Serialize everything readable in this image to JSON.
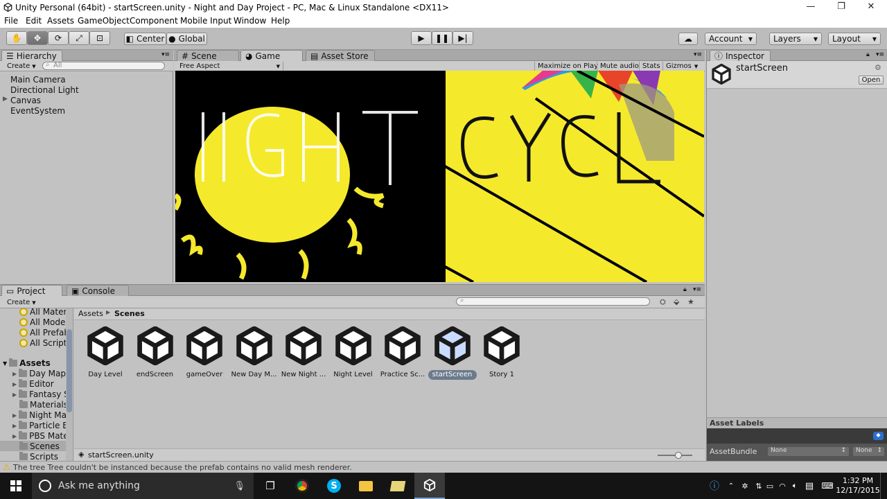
{
  "window": {
    "title": "Unity Personal (64bit) - startScreen.unity - Night and Day Project - PC, Mac & Linux Standalone <DX11>",
    "min": "—",
    "max": "❐",
    "close": "✕"
  },
  "menu": [
    "File",
    "Edit",
    "Assets",
    "GameObject",
    "Component",
    "Mobile Input",
    "Window",
    "Help"
  ],
  "toolbar": {
    "pivot": "Center",
    "space": "Global",
    "account": "Account",
    "layers": "Layers",
    "layout": "Layout"
  },
  "hierarchy": {
    "tab": "Hierarchy",
    "create": "Create",
    "search_placeholder": "All",
    "items": [
      "Main Camera",
      "Directional Light",
      "Canvas",
      "EventSystem"
    ]
  },
  "center_tabs": {
    "scene": "Scene",
    "game": "Game",
    "store": "Asset Store"
  },
  "game_bar": {
    "aspect": "Free Aspect",
    "maximize": "Maximize on Play",
    "mute": "Mute audio",
    "stats": "Stats",
    "gizmos": "Gizmos"
  },
  "inspector": {
    "tab": "Inspector",
    "object": "startScreen",
    "open": "Open",
    "labels_title": "Asset Labels",
    "bundle_label": "AssetBundle",
    "bundle_value": "None",
    "variant_value": "None"
  },
  "project": {
    "tab": "Project",
    "console": "Console",
    "create": "Create",
    "breadcrumb_root": "Assets",
    "breadcrumb_leaf": "Scenes",
    "search_items": [
      "All Materi",
      "All Models",
      "All Prefab",
      "All Scripts"
    ],
    "root": "Assets",
    "folders": [
      "Day Map",
      "Editor",
      "Fantasy S",
      "Materials",
      "Night Map",
      "Particle E",
      "PBS Mate",
      "Scenes",
      "Scripts"
    ],
    "assets": [
      "Day Level",
      "endScreen",
      "gameOver",
      "New Day M...",
      "New Night ...",
      "Night Level",
      "Practice Sc...",
      "startScreen",
      "Story 1"
    ],
    "selected_asset": "startScreen",
    "footer_file": "startScreen.unity"
  },
  "status": "The tree Tree couldn't be instanced because the prefab contains no valid mesh renderer.",
  "taskbar": {
    "search": "Ask me anything",
    "time": "1:32 PM",
    "date": "12/17/2015"
  },
  "colors": {
    "game_yellow": "#f5e92c",
    "selection": "#6b7b8c"
  }
}
